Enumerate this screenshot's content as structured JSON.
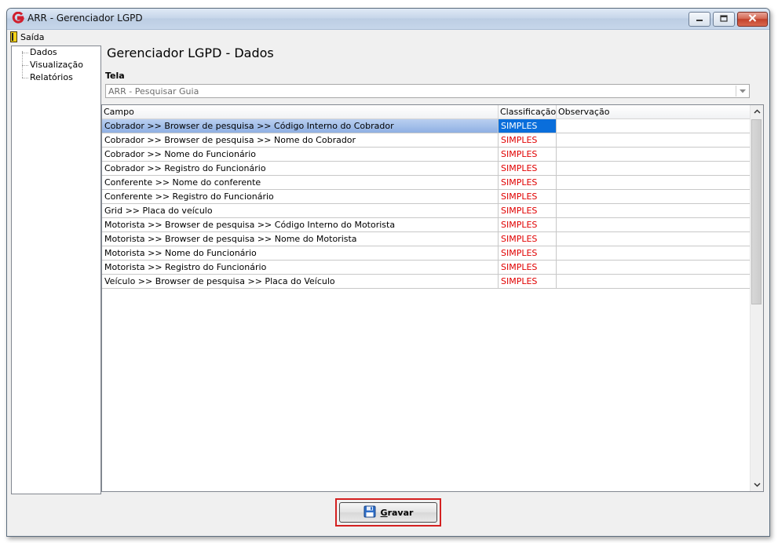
{
  "window": {
    "title": "ARR - Gerenciador LGPD"
  },
  "menu": {
    "exit_label": "Saída"
  },
  "tree": {
    "items": [
      "Dados",
      "Visualização",
      "Relatórios"
    ]
  },
  "main": {
    "heading": "Gerenciador LGPD - Dados",
    "tela_label": "Tela",
    "tela_value": "ARR - Pesquisar Guia"
  },
  "grid": {
    "columns": [
      "Campo",
      "Classificação",
      "Observação"
    ],
    "rows": [
      {
        "campo": "Cobrador >> Browser de pesquisa >> Código Interno do Cobrador",
        "classificacao": "SIMPLES",
        "observacao": ""
      },
      {
        "campo": "Cobrador >> Browser de pesquisa >> Nome do Cobrador",
        "classificacao": "SIMPLES",
        "observacao": ""
      },
      {
        "campo": "Cobrador >> Nome do Funcionário",
        "classificacao": "SIMPLES",
        "observacao": ""
      },
      {
        "campo": "Cobrador >> Registro do Funcionário",
        "classificacao": "SIMPLES",
        "observacao": ""
      },
      {
        "campo": "Conferente >> Nome do conferente",
        "classificacao": "SIMPLES",
        "observacao": ""
      },
      {
        "campo": "Conferente >> Registro do Funcionário",
        "classificacao": "SIMPLES",
        "observacao": ""
      },
      {
        "campo": "Grid >> Placa do veículo",
        "classificacao": "SIMPLES",
        "observacao": ""
      },
      {
        "campo": "Motorista >> Browser de pesquisa >> Código Interno do Motorista",
        "classificacao": "SIMPLES",
        "observacao": ""
      },
      {
        "campo": "Motorista >> Browser de pesquisa >> Nome do Motorista",
        "classificacao": "SIMPLES",
        "observacao": ""
      },
      {
        "campo": "Motorista >> Nome do Funcionário",
        "classificacao": "SIMPLES",
        "observacao": ""
      },
      {
        "campo": "Motorista >> Registro do Funcionário",
        "classificacao": "SIMPLES",
        "observacao": ""
      },
      {
        "campo": "Veículo >> Browser de pesquisa >> Placa do Veículo",
        "classificacao": "SIMPLES",
        "observacao": ""
      }
    ]
  },
  "footer": {
    "save_label": "Gravar"
  },
  "colors": {
    "classification_text": "#e00000",
    "selection": "#0a6edb",
    "highlight_frame": "#d42020"
  }
}
